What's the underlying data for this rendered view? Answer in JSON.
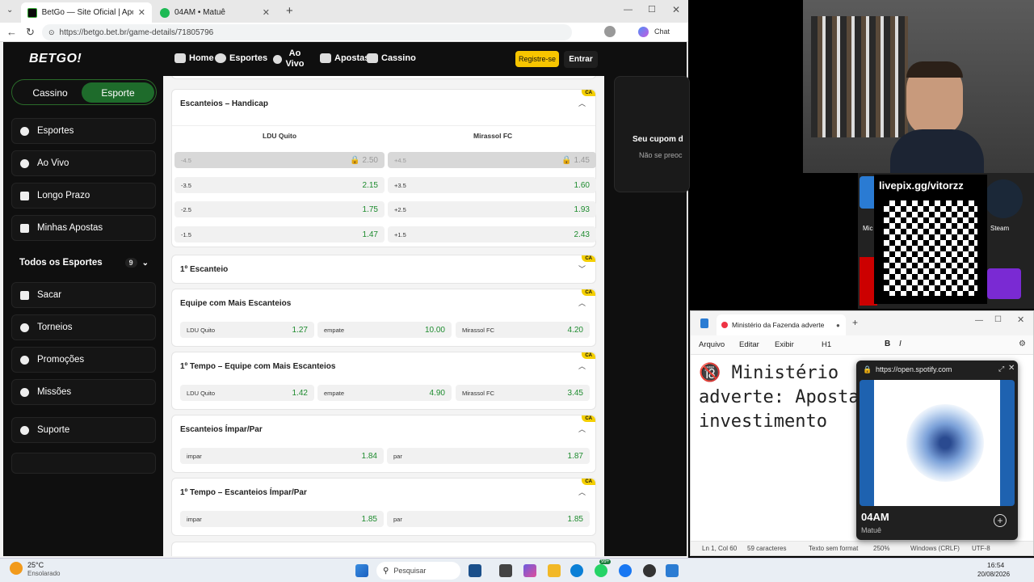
{
  "browser": {
    "tabs": [
      {
        "title": "BetGo — Site Oficial | Apostas Esp"
      },
      {
        "title": "04AM • Matuê"
      }
    ],
    "url": "https://betgo.bet.br/game-details/71805796",
    "chat_label": "Chat"
  },
  "site": {
    "logo": "BETGO!",
    "nav": [
      "Home",
      "Esportes",
      "Ao Vivo",
      "Apostas",
      "Cassino"
    ],
    "register": "Registre-se",
    "login": "Entrar"
  },
  "sidebar": {
    "toggle": [
      "Cassino",
      "Esporte"
    ],
    "items": [
      "Esportes",
      "Ao Vivo",
      "Longo Prazo",
      "Minhas Apostas"
    ],
    "all_sports": "Todos os Esportes",
    "all_sports_count": "9",
    "items2": [
      "Sacar",
      "Torneios",
      "Promoções",
      "Missões"
    ],
    "support": "Suporte"
  },
  "markets": {
    "handicap": {
      "title": "Escanteios – Handicap",
      "team1": "LDU Quito",
      "team2": "Mirassol FC",
      "rows": [
        {
          "l": "-4.5",
          "lv": "2.50",
          "r": "+4.5",
          "rv": "1.45"
        },
        {
          "l": "-3.5",
          "lv": "2.15",
          "r": "+3.5",
          "rv": "1.60"
        },
        {
          "l": "-2.5",
          "lv": "1.75",
          "r": "+2.5",
          "rv": "1.93"
        },
        {
          "l": "-1.5",
          "lv": "1.47",
          "r": "+1.5",
          "rv": "2.43"
        }
      ]
    },
    "first_corner": {
      "title": "1º Escanteio"
    },
    "most_corners": {
      "title": "Equipe com Mais Escanteios",
      "odds": [
        [
          "LDU Quito",
          "1.27"
        ],
        [
          "empate",
          "10.00"
        ],
        [
          "Mirassol FC",
          "4.20"
        ]
      ]
    },
    "ht_most_corners": {
      "title": "1º Tempo – Equipe com Mais Escanteios",
      "odds": [
        [
          "LDU Quito",
          "1.42"
        ],
        [
          "empate",
          "4.90"
        ],
        [
          "Mirassol FC",
          "3.45"
        ]
      ]
    },
    "odd_even": {
      "title": "Escanteios Ímpar/Par",
      "odds": [
        [
          "impar",
          "1.84"
        ],
        [
          "par",
          "1.87"
        ]
      ]
    },
    "ht_odd_even": {
      "title": "1º Tempo – Escanteios Ímpar/Par",
      "odds": [
        [
          "impar",
          "1.85"
        ],
        [
          "par",
          "1.85"
        ]
      ]
    },
    "badge": "CA"
  },
  "coupon": {
    "title": "Seu cupom d",
    "text": "Não se preoc"
  },
  "overlay": {
    "livepix": "livepix.gg/vitorzz",
    "steam": "Steam",
    "mic": "Mic"
  },
  "notepad": {
    "tab_title": "Ministério da Fazenda adverte",
    "menu": [
      "Arquivo",
      "Editar",
      "Exibir"
    ],
    "heading": "H1",
    "content_line1": "🔞 Ministério",
    "content_line2": "adverte: Aposta",
    "content_line3": "investimento",
    "status": [
      "Ln 1, Col 60",
      "59 caracteres",
      "Texto sem format",
      "250%",
      "Windows (CRLF)",
      "UTF-8"
    ]
  },
  "spotify": {
    "url": "https://open.spotify.com",
    "track": "04AM",
    "artist": "Matuê"
  },
  "taskbar": {
    "weather_temp": "25°C",
    "weather_desc": "Ensolarado",
    "search": "Pesquisar",
    "time": "16:54",
    "date": "20/08/2026",
    "notif_count": "99+"
  }
}
